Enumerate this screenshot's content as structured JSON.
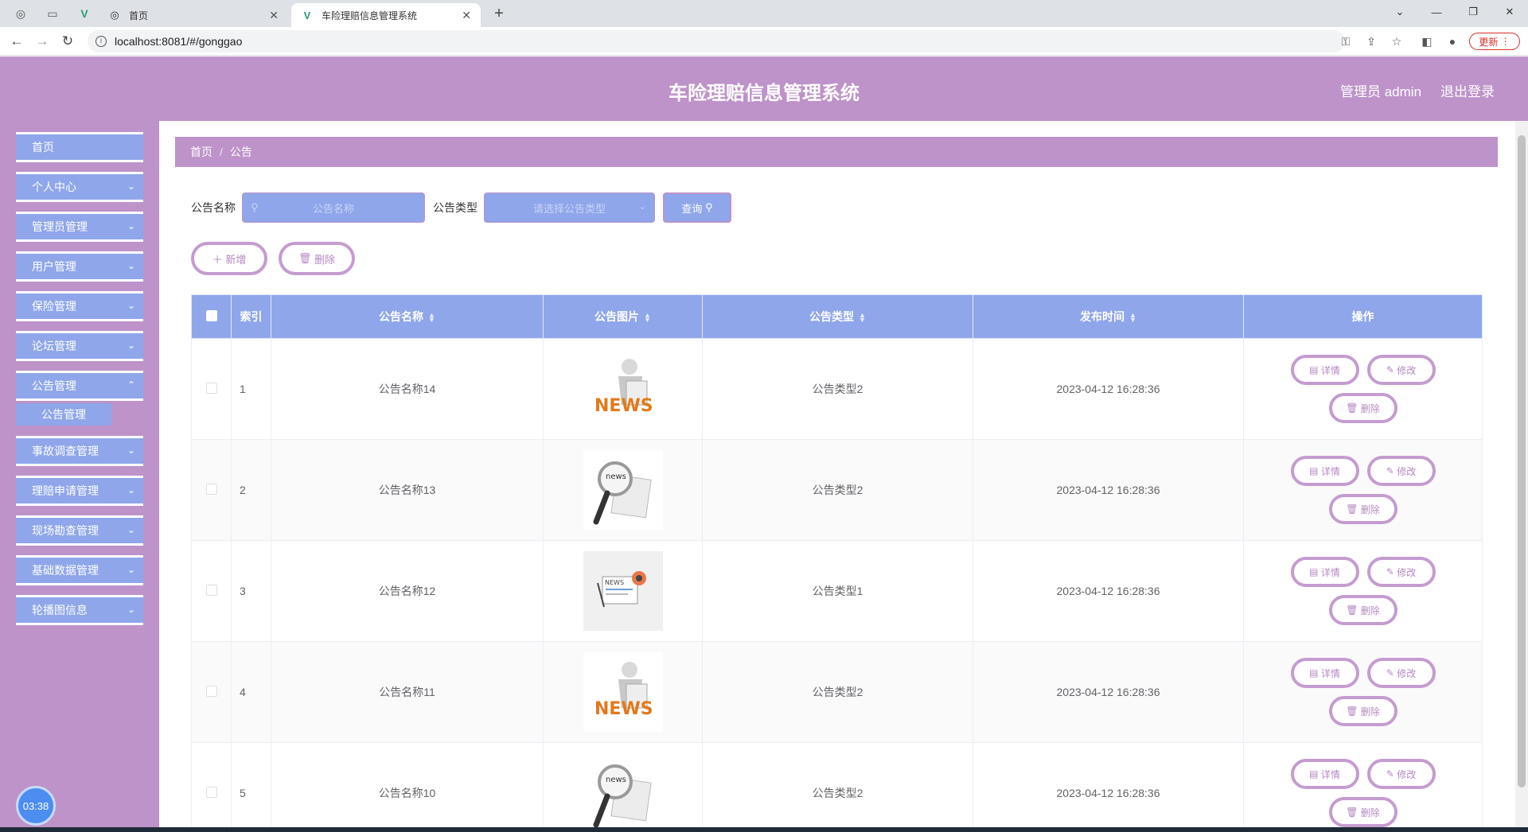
{
  "browser": {
    "tabs": [
      {
        "label": "首页",
        "active": false
      },
      {
        "label": "车险理赔信息管理系统",
        "active": true
      }
    ],
    "url": "localhost:8081/#/gonggao",
    "update_label": "更新"
  },
  "header": {
    "title": "车险理赔信息管理系统",
    "user": "管理员 admin",
    "logout": "退出登录"
  },
  "sidebar": {
    "items": [
      {
        "label": "首页"
      },
      {
        "label": "个人中心"
      },
      {
        "label": "管理员管理"
      },
      {
        "label": "用户管理"
      },
      {
        "label": "保险管理"
      },
      {
        "label": "论坛管理"
      },
      {
        "label": "公告管理"
      },
      {
        "label": "事故调查管理"
      },
      {
        "label": "理赔申请管理"
      },
      {
        "label": "现场勘查管理"
      },
      {
        "label": "基础数据管理"
      },
      {
        "label": "轮播图信息"
      }
    ],
    "submenu": {
      "label": "公告管理"
    },
    "clock": "03:38"
  },
  "breadcrumb": {
    "home": "首页",
    "current": "公告"
  },
  "search": {
    "name_label": "公告名称",
    "name_placeholder": "公告名称",
    "type_label": "公告类型",
    "type_placeholder": "请选择公告类型",
    "query_label": "查询"
  },
  "actions": {
    "add": "新增",
    "delete": "删除"
  },
  "table": {
    "headers": {
      "index": "索引",
      "name": "公告名称",
      "image": "公告图片",
      "type": "公告类型",
      "time": "发布时间",
      "ops": "操作"
    },
    "rows": [
      {
        "index": "1",
        "name": "公告名称14",
        "image": "news-reader",
        "type": "公告类型2",
        "time": "2023-04-12 16:28:36"
      },
      {
        "index": "2",
        "name": "公告名称13",
        "image": "news-magnifier",
        "type": "公告类型2",
        "time": "2023-04-12 16:28:36"
      },
      {
        "index": "3",
        "name": "公告名称12",
        "image": "news-paper",
        "type": "公告类型1",
        "time": "2023-04-12 16:28:36"
      },
      {
        "index": "4",
        "name": "公告名称11",
        "image": "news-reader",
        "type": "公告类型2",
        "time": "2023-04-12 16:28:36"
      },
      {
        "index": "5",
        "name": "公告名称10",
        "image": "news-magnifier",
        "type": "公告类型2",
        "time": "2023-04-12 16:28:36"
      }
    ],
    "op_labels": {
      "detail": "详情",
      "edit": "修改",
      "delete": "删除"
    }
  },
  "colors": {
    "accent_purple": "#bd93c9",
    "accent_blue": "#8fa6ea"
  }
}
